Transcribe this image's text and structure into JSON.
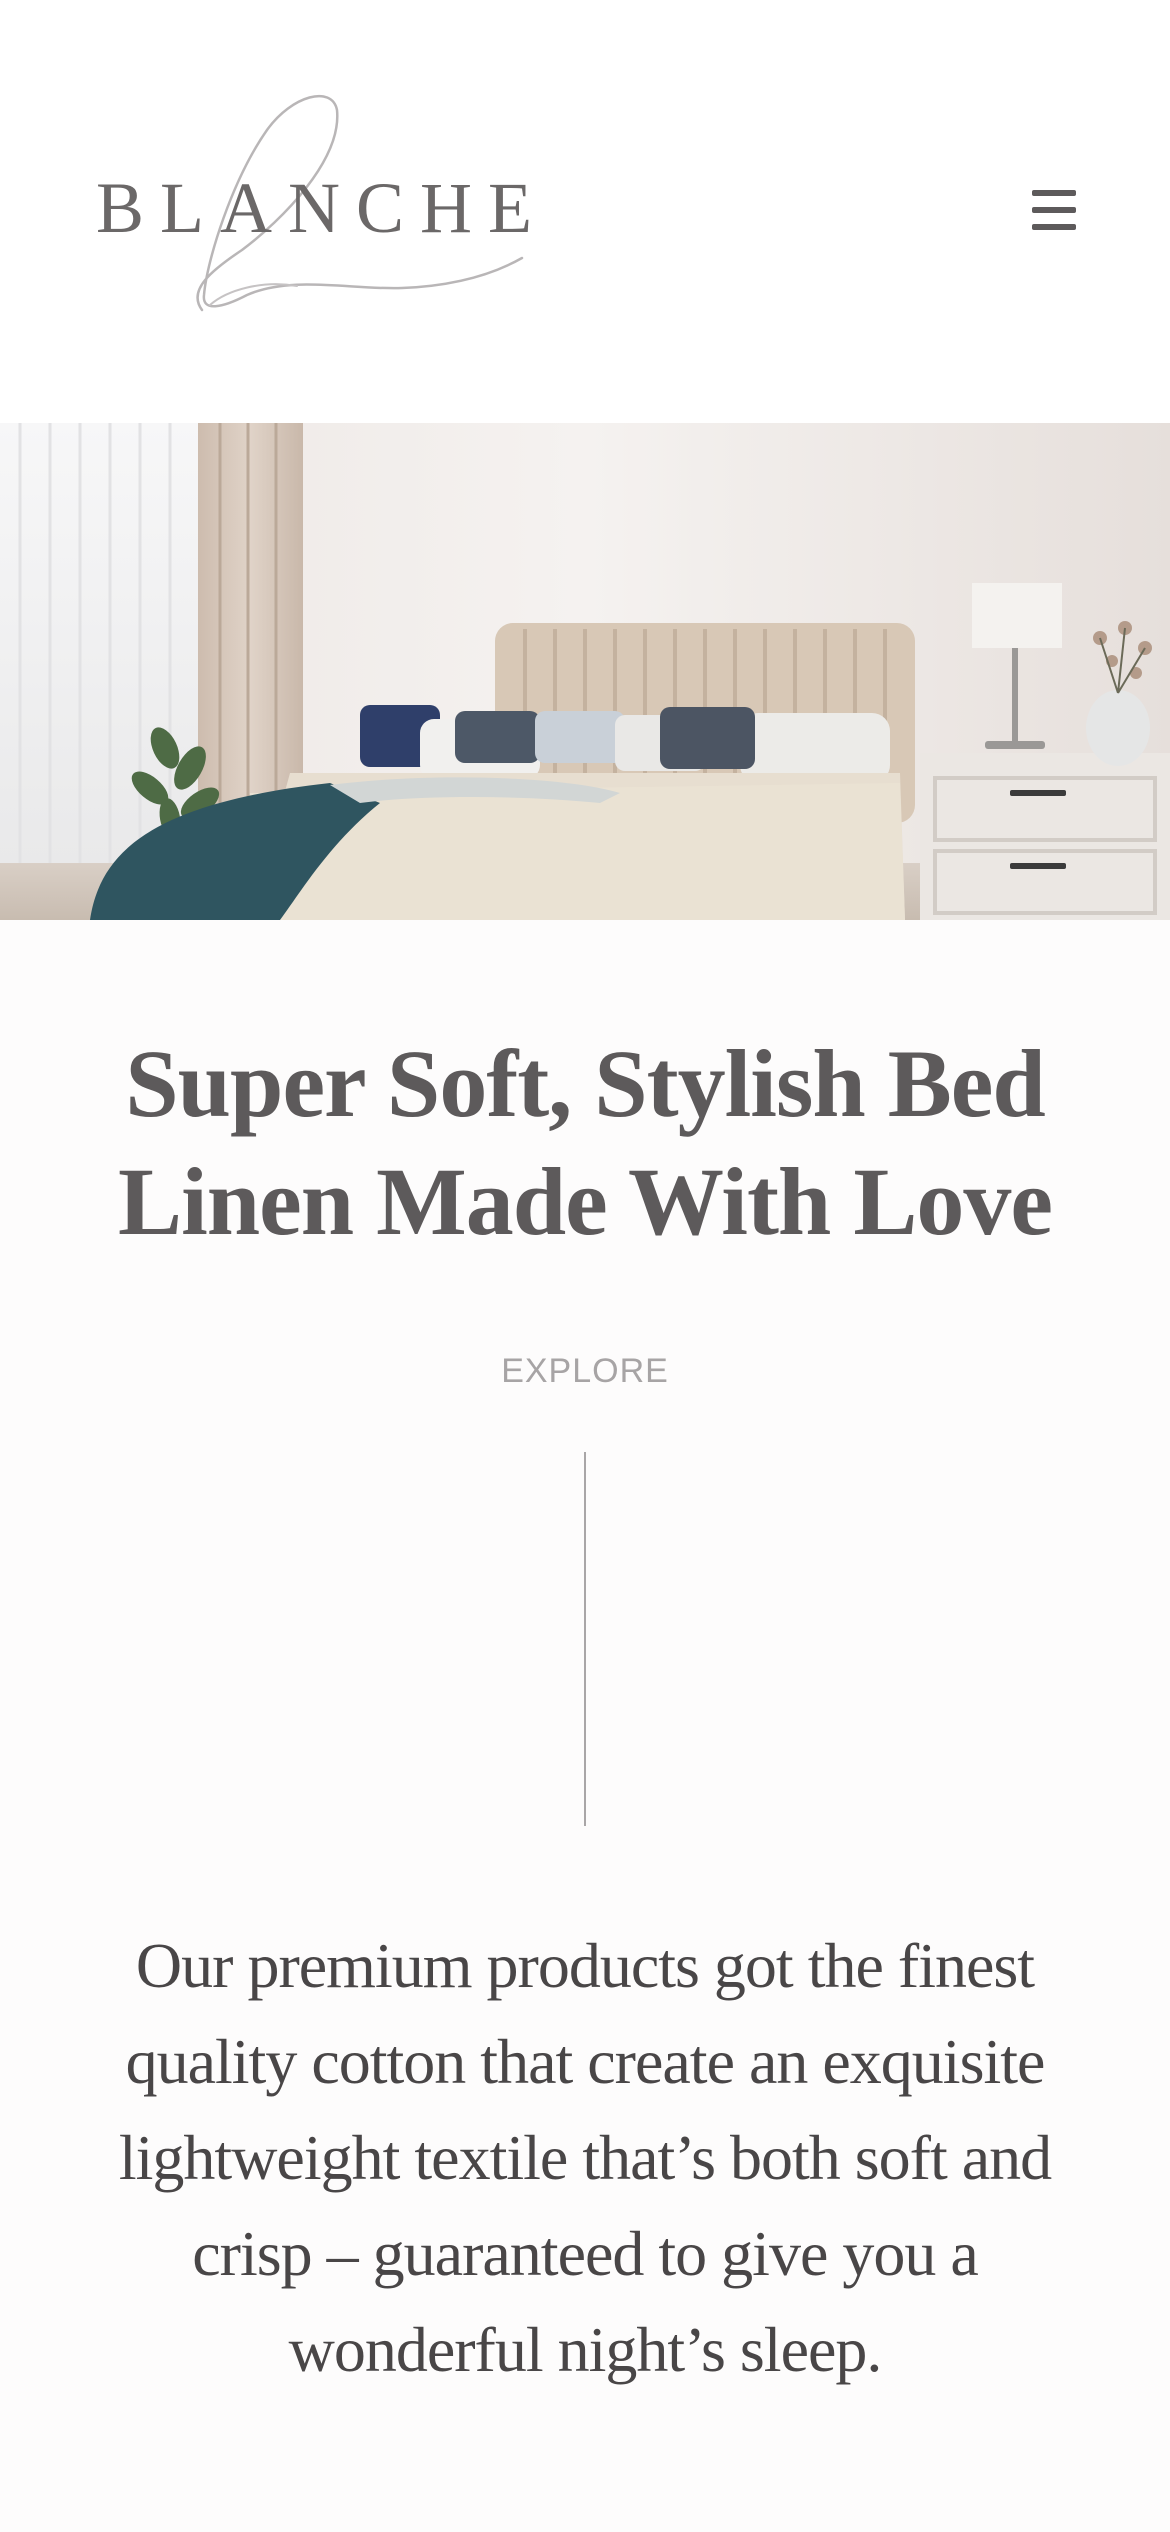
{
  "brand": {
    "logo_text": "BLANCHE",
    "logo_icon": "script-b-flourish"
  },
  "header": {
    "menu_icon": "hamburger-menu-icon"
  },
  "hero": {
    "image_description_icon": "bedroom-hero-image"
  },
  "main": {
    "headline": "Super Soft, Stylish Bed Linen Made With Love",
    "explore_label": "EXPLORE",
    "body_copy": "Our premium products got the finest quality cotton that create an exquisite lightweight textile that’s both soft and crisp – guaranteed to give you a wonderful night’s sleep."
  },
  "colors": {
    "text": "#5d5a5b",
    "muted": "#a7a4a5",
    "background": "#fdfcfc"
  }
}
